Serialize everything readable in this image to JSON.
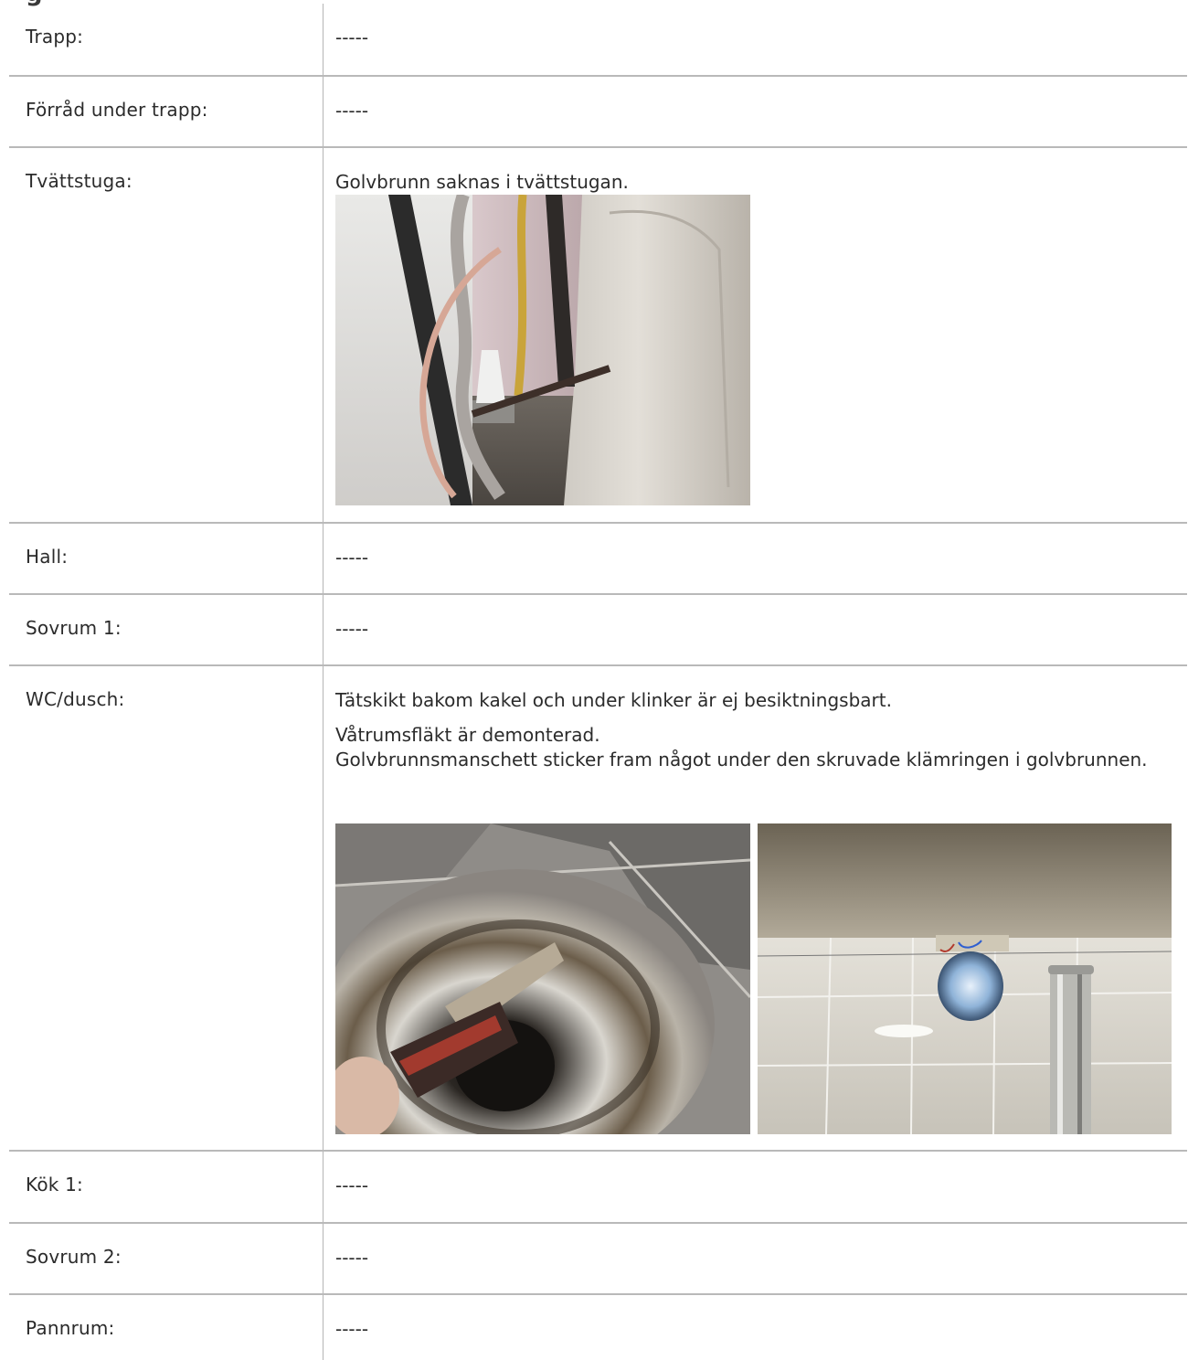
{
  "page": {
    "heading_partial": "g"
  },
  "rows": [
    {
      "label": "Trapp:",
      "value": "-----"
    },
    {
      "label": "Förråd under trapp:",
      "value": "-----"
    },
    {
      "label": "Tvättstuga:",
      "value": "Golvbrunn saknas i tvättstugan."
    },
    {
      "label": "Hall:",
      "value": "-----"
    },
    {
      "label": "Sovrum 1:",
      "value": "-----"
    },
    {
      "label": "WC/dusch:",
      "lines": [
        "Tätskikt bakom kakel och under klinker är ej besiktningsbart.",
        "Våtrumsfläkt är demonterad.",
        "Golvbrunnsmanschett sticker fram något under den skruvade klämringen i golvbrunnen."
      ]
    },
    {
      "label": "Kök 1:",
      "value": "-----"
    },
    {
      "label": "Sovrum 2:",
      "value": "-----"
    },
    {
      "label": "Pannrum:",
      "value": "-----"
    }
  ]
}
